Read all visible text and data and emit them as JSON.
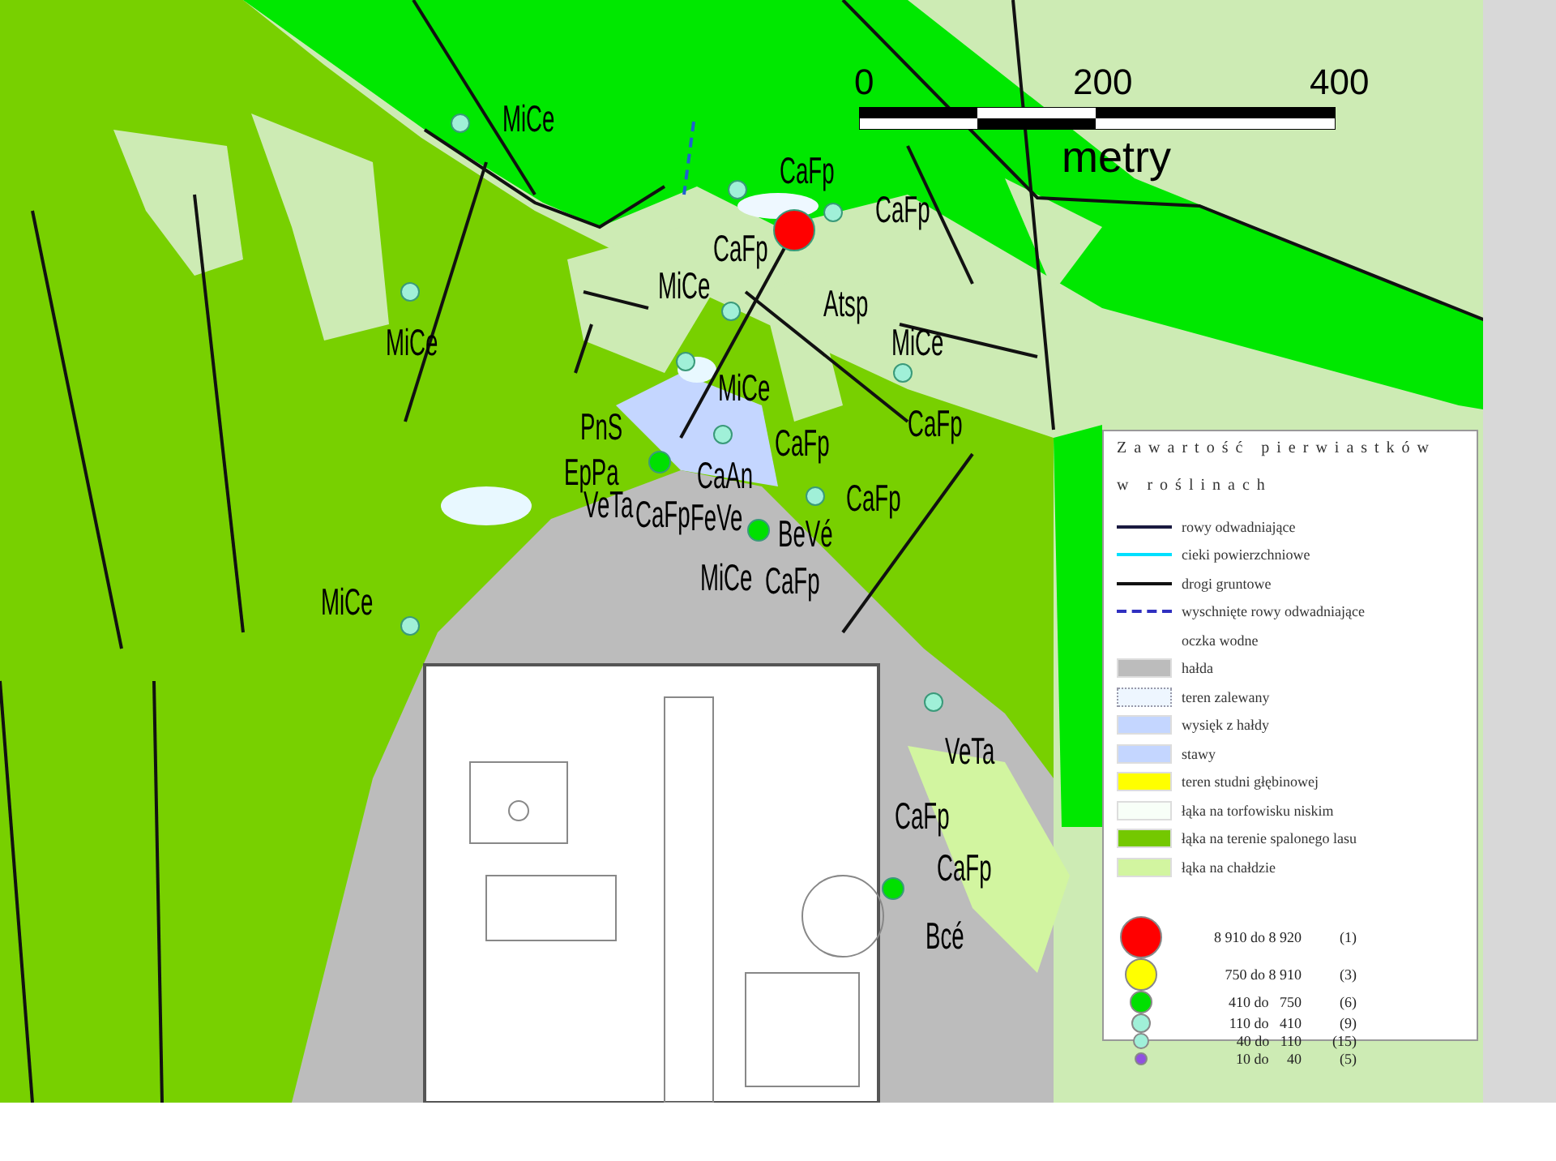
{
  "scale_bar": {
    "ticks": [
      "0",
      "200",
      "400"
    ],
    "unit": "metry"
  },
  "sample_points": [
    {
      "color": "#a0f0d8",
      "labels": [
        "MiCe"
      ]
    },
    {
      "color": "#a0f0d8",
      "labels": [
        "MiCe"
      ]
    },
    {
      "color": "#a0f0d8",
      "labels": [
        "CaFp"
      ]
    },
    {
      "color": "#ff0000",
      "labels": [
        "Atsp"
      ]
    },
    {
      "color": "#a0f0d8",
      "labels": [
        "CaFp",
        "MiCe"
      ]
    },
    {
      "color": "#a0f0d8",
      "labels": [
        "CaFp"
      ]
    },
    {
      "color": "#a0f0d8",
      "labels": [
        "MiCe"
      ]
    },
    {
      "color": "#a0f0d8",
      "labels": [
        "MiCe",
        "CaFp"
      ]
    },
    {
      "color": "#a0f0d8",
      "labels": [
        "CaFp"
      ]
    },
    {
      "color": "#a0f0d8",
      "labels": [
        "CaFp"
      ]
    },
    {
      "color": "#00e000",
      "labels": [
        "PnS",
        "EpPa",
        "VeTa",
        "CaFp",
        "CaAn",
        "FeVe"
      ]
    },
    {
      "color": "#00e000",
      "labels": [
        "BeVé",
        "MiCe",
        "CaFp"
      ]
    },
    {
      "color": "#a0f0d8",
      "labels": [
        "MiCe"
      ]
    },
    {
      "color": "#a0f0d8",
      "labels": [
        "VeTa"
      ]
    },
    {
      "color": "#00e000",
      "labels": [
        "CaFp",
        "CaFp",
        "Bcé"
      ]
    }
  ],
  "legend": {
    "title": [
      "Zawartość pierwiastków",
      "w roślinach"
    ],
    "items": [
      {
        "kind": "line",
        "color": "#1a1a40",
        "label": "rowy odwadniające"
      },
      {
        "kind": "line",
        "color": "#00e0ff",
        "label": "cieki powierzchniowe"
      },
      {
        "kind": "line",
        "color": "#111111",
        "label": "drogi gruntowe"
      },
      {
        "kind": "dashed",
        "color": "#3030c0",
        "label": "wyschnięte rowy odwadniające"
      },
      {
        "kind": "none",
        "label": "oczka wodne"
      },
      {
        "kind": "fill",
        "color": "#bcbcbc",
        "label": "hałda"
      },
      {
        "kind": "dotted",
        "color": "#eef6ff",
        "label": "teren zalewany"
      },
      {
        "kind": "fill",
        "color": "#c4d6ff",
        "label": "wysięk z hałdy"
      },
      {
        "kind": "fill",
        "color": "#c4d6ff",
        "label": "stawy"
      },
      {
        "kind": "fill",
        "color": "#ffff00",
        "label": "teren studni głębinowej"
      },
      {
        "kind": "fill",
        "color": "#f8fff8",
        "label": "łąka na torfowisku niskim"
      },
      {
        "kind": "fill",
        "color": "#74c800",
        "label": "łąka na terenie spalonego lasu"
      },
      {
        "kind": "fill",
        "color": "#d2f5a0",
        "label": "łąka na chałdzie"
      }
    ],
    "classes": [
      {
        "color": "#ff0000",
        "range": "8 910 do 8 920",
        "count": "(1)"
      },
      {
        "color": "#ffff00",
        "range": "750 do 8 910",
        "count": "(3)"
      },
      {
        "color": "#00e000",
        "range": "410 do   750",
        "count": "(6)"
      },
      {
        "color": "#a0f0d8",
        "range": "110 do   410",
        "count": "(9)"
      },
      {
        "color": "#a0f0d9",
        "range": "40 do   110",
        "count": "(15)"
      },
      {
        "color": "#9050e0",
        "range": "10 do     40",
        "count": "(5)"
      }
    ]
  }
}
